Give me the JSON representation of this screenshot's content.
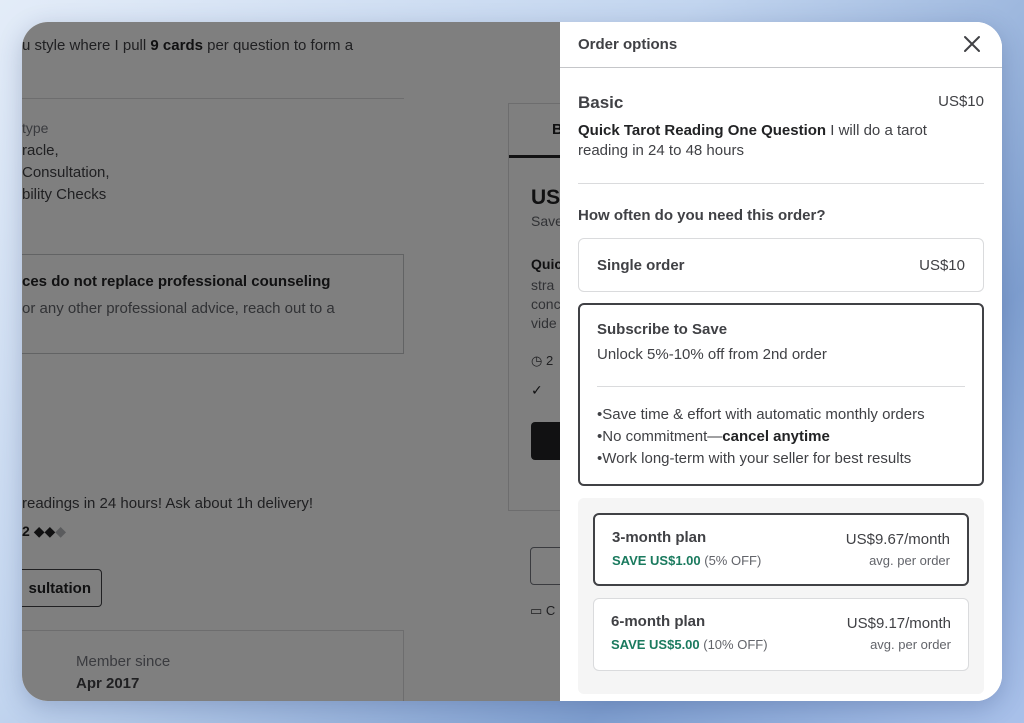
{
  "background": {
    "intro_prefix": "u style where I pull ",
    "intro_bold": "9 cards",
    "intro_suffix": " per question to form a",
    "type_title": "type",
    "type_items": [
      "racle,",
      " Consultation,",
      "bility Checks"
    ],
    "notice_title": "ces do not replace professional counseling",
    "notice_text": "or any other professional advice, reach out to a",
    "promo": "readings in 24 hours! Ask about 1h delivery!",
    "rating_value": "2",
    "consult_button": "sultation",
    "member_since_label": "Member since",
    "member_since_value": "Apr 2017",
    "tab_label": "B",
    "price": "US",
    "save": "Save",
    "desc_title": "Quic",
    "desc_lines": [
      "stra",
      "conc",
      "vide"
    ],
    "clock_text": "2",
    "video_text": "C"
  },
  "drawer": {
    "title": "Order options",
    "close_icon": "close-icon",
    "package": {
      "name": "Basic",
      "price": "US$10",
      "desc_bold": "Quick Tarot Reading One Question",
      "desc_text": " I will do a tarot reading in 24 to 48 hours"
    },
    "frequency_question": "How often do you need this order?",
    "single_order": {
      "label": "Single order",
      "price": "US$10"
    },
    "subscribe": {
      "title": "Subscribe to Save",
      "subtitle": "Unlock 5%-10% off from 2nd order",
      "bullet1": "•Save time & effort with automatic monthly orders",
      "bullet2_prefix": "•No commitment—",
      "bullet2_bold": "cancel anytime",
      "bullet3": "•Work long-term with your seller for best results"
    },
    "plans": [
      {
        "name": "3-month plan",
        "save": "SAVE US$1.00",
        "off": " (5% OFF)",
        "price": "US$9.67/month",
        "avg": "avg. per order",
        "selected": true
      },
      {
        "name": "6-month plan",
        "save": "SAVE US$5.00",
        "off": " (10% OFF)",
        "price": "US$9.17/month",
        "avg": "avg. per order",
        "selected": false
      }
    ]
  },
  "colors": {
    "save_green": "#1a7a5e",
    "text_dark": "#404145",
    "overlay": "rgba(0,0,0,0.5)"
  }
}
